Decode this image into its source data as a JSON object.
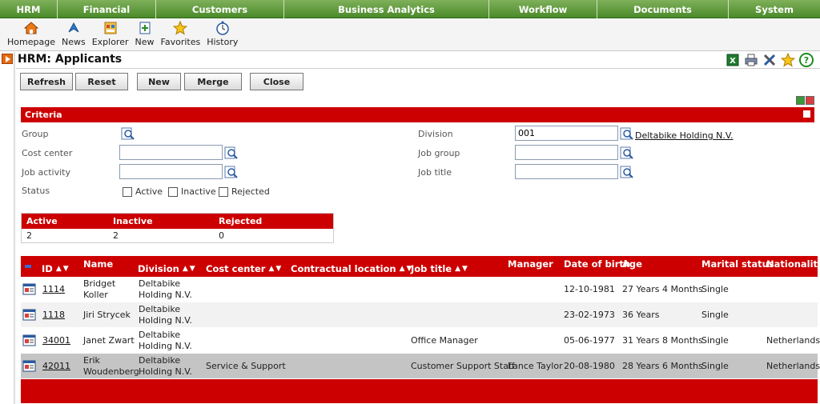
{
  "menu": [
    "HRM",
    "Financial",
    "Customers",
    "Business Analytics",
    "Workflow",
    "Documents",
    "System"
  ],
  "toolbar": [
    "Homepage",
    "News",
    "Explorer",
    "New",
    "Favorites",
    "History"
  ],
  "page": {
    "title": "HRM: Applicants"
  },
  "actions": [
    "Refresh",
    "Reset",
    "New",
    "Merge",
    "Close"
  ],
  "criteria": {
    "header": "Criteria",
    "labels": {
      "group": "Group",
      "cost_center": "Cost center",
      "job_activity": "Job activity",
      "status": "Status",
      "division": "Division",
      "job_group": "Job group",
      "job_title": "Job title"
    },
    "values": {
      "cost_center": "",
      "job_activity": "",
      "division": "001",
      "division_name": "Deltabike Holding N.V.",
      "job_group": "",
      "job_title": ""
    },
    "status_options": [
      "Active",
      "Inactive",
      "Rejected"
    ]
  },
  "summary": {
    "headers": [
      "Active",
      "Inactive",
      "Rejected"
    ],
    "values": [
      "2",
      "2",
      "0"
    ]
  },
  "grid": {
    "headers": {
      "id": "ID",
      "name": "Name",
      "division": "Division",
      "cost_center": "Cost center",
      "contractual_location": "Contractual location",
      "job_title": "Job title",
      "manager": "Manager",
      "date_of_birth": "Date of birth",
      "age": "Age",
      "marital_status": "Marital status",
      "nationality": "Nationality"
    },
    "rows": [
      {
        "id": "1114",
        "name1": "Bridget",
        "name2": "Koller",
        "div1": "Deltabike",
        "div2": "Holding N.V.",
        "cost_center": "",
        "job_title": "",
        "manager": "",
        "dob": "12-10-1981",
        "age": "27 Years 4 Months",
        "marital": "Single",
        "nationality": ""
      },
      {
        "id": "1118",
        "name1": "Jiri Strycek",
        "name2": "",
        "div1": "Deltabike",
        "div2": "Holding N.V.",
        "cost_center": "",
        "job_title": "",
        "manager": "",
        "dob": "23-02-1973",
        "age": "36 Years",
        "marital": "Single",
        "nationality": ""
      },
      {
        "id": "34001",
        "name1": "Janet Zwart",
        "name2": "",
        "div1": "Deltabike",
        "div2": "Holding N.V.",
        "cost_center": "",
        "job_title": "Office Manager",
        "manager": "",
        "dob": "05-06-1977",
        "age": "31 Years 8 Months",
        "marital": "Single",
        "nationality": "Netherlands"
      },
      {
        "id": "42011",
        "name1": "Erik",
        "name2": "Woudenberg",
        "div1": "Deltabike",
        "div2": "Holding N.V.",
        "cost_center": "Service & Support",
        "job_title": "Customer Support Staff",
        "manager": "Lance Taylor",
        "dob": "20-08-1980",
        "age": "28 Years 6 Months",
        "marital": "Single",
        "nationality": "Netherlands"
      }
    ]
  },
  "colors": {
    "menu_green": "#4a8a2a",
    "header_red": "#cc0000",
    "selected_row": "#c4c4c4"
  }
}
